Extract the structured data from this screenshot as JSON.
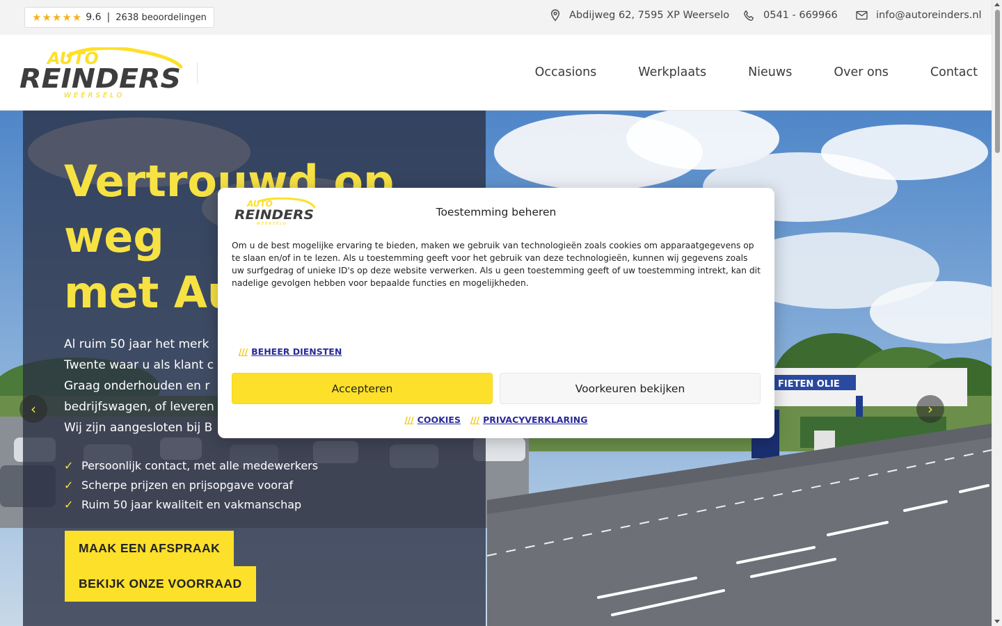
{
  "topbar": {
    "rating_stars": "★★★★★",
    "rating_score": "9.6",
    "rating_sep": "|",
    "rating_count": "2638 beoordelingen",
    "address": "Abdijweg 62, 7595 XP Weerselo",
    "phone": "0541 - 669966",
    "email": "info@autoreinders.nl",
    "icons": [
      "map-pin-icon",
      "phone-icon",
      "mail-icon"
    ]
  },
  "brand": {
    "logo_top": "AUTO",
    "logo_main": "REINDERS",
    "logo_sub": "WEERSELO",
    "yellow": "#fde02a",
    "dark": "#3a3a3a"
  },
  "nav": {
    "items": [
      "Occasions",
      "Werkplaats",
      "Nieuws",
      "Over ons",
      "Contact"
    ]
  },
  "hero": {
    "title_lines": [
      "Vertrouwd op",
      "weg",
      "met Au"
    ],
    "text_lines": [
      "Al ruim 50 jaar het merk",
      "Twente waar u als klant c",
      "Graag onderhouden en r",
      "bedrijfswagen, of leveren",
      "Wij zijn aangesloten bij B"
    ],
    "usps": [
      "Persoonlijk contact, met alle medewerkers",
      "Scherpe prijzen en prijsopgave vooraf",
      "Ruim 50 jaar kwaliteit en vakmanschap"
    ],
    "cta_primary": "MAAK EEN AFSPRAAK",
    "cta_secondary": "BEKIJK ONZE VOORRAAD",
    "prev_arrow": "‹",
    "next_arrow": "›",
    "sign_text": "FIETEN OLIE"
  },
  "cookie": {
    "title": "Toestemming beheren",
    "body": "Om u de best mogelijke ervaring te bieden, maken we gebruik van technologieën zoals cookies om apparaatgegevens op te slaan en/of in te lezen. Als u toestemming geeft voor het gebruik van deze technologieën, kunnen wij gegevens zoals uw surfgedrag of unieke ID's op deze website verwerken. Als u geen toestemming geeft of uw toestemming intrekt, kan dit nadelige gevolgen hebben voor bepaalde functies en mogelijkheden.",
    "slash": "///",
    "manage_label": "BEHEER DIENSTEN",
    "accept_label": "Accepteren",
    "prefs_label": "Voorkeuren bekijken",
    "cookies_link": "COOKIES",
    "privacy_link": "PRIVACYVERKLARING"
  }
}
